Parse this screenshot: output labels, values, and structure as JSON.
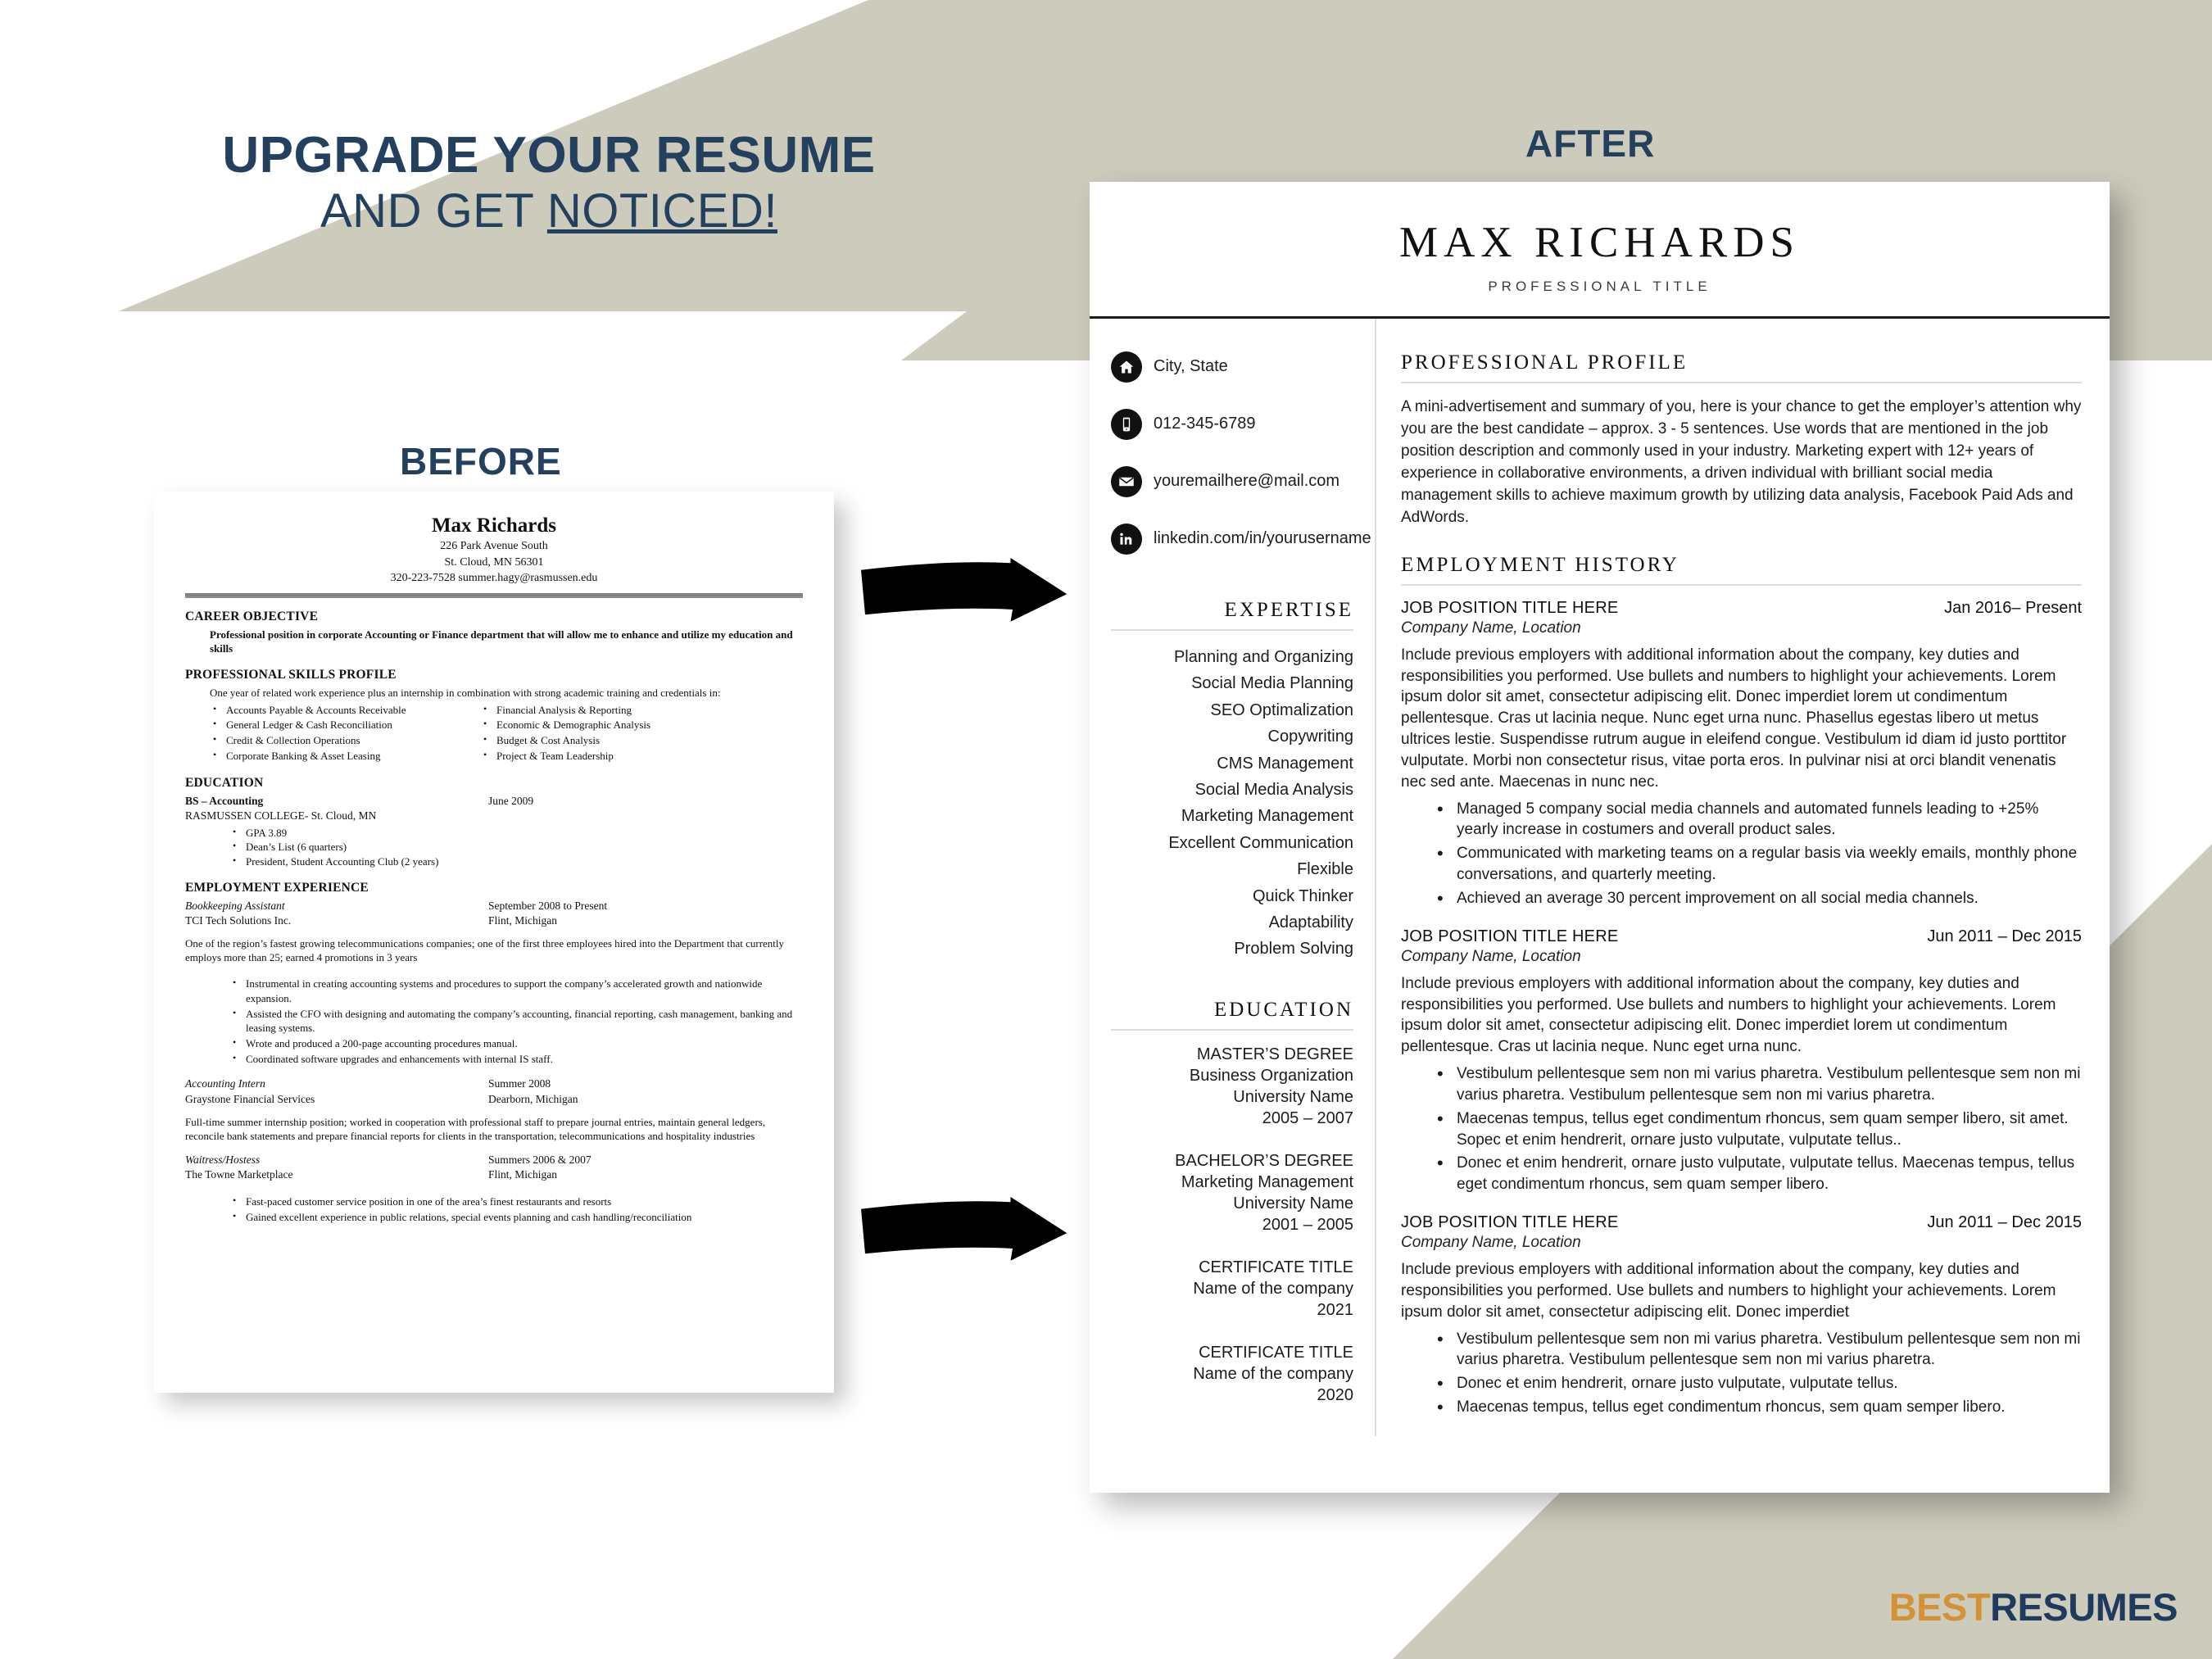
{
  "promo": {
    "headline_line1": "UPGRADE YOUR RESUME",
    "headline_line2_prefix": "AND GET ",
    "headline_line2_underlined": "NOTICED!",
    "label_before": "BEFORE",
    "label_after": "AFTER",
    "arrow_top_name": "arrow-before-to-after-top",
    "arrow_bottom_name": "arrow-before-to-after-bottom"
  },
  "brand": {
    "logo_part1": "BEST",
    "logo_part2": "RESUMES",
    "color_gold": "#d29235",
    "color_navy": "#1f3a5c",
    "color_beige": "#cdcbbc"
  },
  "before_resume": {
    "name": "Max Richards",
    "address_line1": "226 Park Avenue South",
    "address_line2": "St. Cloud, MN 56301",
    "address_line3": "320-223-7528 summer.hagy@rasmussen.edu",
    "sections": {
      "career_objective": {
        "heading": "CAREER OBJECTIVE",
        "text": "Professional position in corporate Accounting or Finance department that will allow me to enhance and utilize my education and skills"
      },
      "skills_profile": {
        "heading": "PROFESSIONAL SKILLS PROFILE",
        "intro": "One year of related work experience plus an internship in combination with strong academic training and credentials in:",
        "column_left": [
          "Accounts Payable & Accounts Receivable",
          "General Ledger & Cash Reconciliation",
          "Credit & Collection Operations",
          "Corporate Banking & Asset Leasing"
        ],
        "column_right": [
          "Financial Analysis & Reporting",
          "Economic & Demographic Analysis",
          "Budget & Cost Analysis",
          "Project & Team Leadership"
        ]
      },
      "education": {
        "heading": "EDUCATION",
        "degree": "BS – Accounting",
        "date": "June 2009",
        "school": "RASMUSSEN COLLEGE- St. Cloud, MN",
        "bullets": [
          "GPA  3.89",
          "Dean’s List (6 quarters)",
          "President, Student Accounting Club (2 years)"
        ]
      },
      "employment": {
        "heading": "EMPLOYMENT EXPERIENCE",
        "jobs": [
          {
            "title": "Bookkeeping Assistant",
            "date": "September 2008 to Present",
            "company": "TCI Tech Solutions Inc.",
            "location": "Flint, Michigan",
            "summary": "One of the region’s fastest growing telecommunications companies; one of the first three employees hired into the Department that currently employs more than 25; earned 4 promotions in 3 years",
            "bullets": [
              "Instrumental in creating accounting systems and procedures to support the company’s accelerated growth and nationwide expansion.",
              "Assisted the CFO with designing and automating the company’s accounting, financial reporting, cash management, banking and leasing systems.",
              "Wrote and produced a 200-page accounting procedures manual.",
              "Coordinated software upgrades and enhancements with internal IS staff."
            ]
          },
          {
            "title": "Accounting Intern",
            "date": "Summer 2008",
            "company": "Graystone Financial Services",
            "location": "Dearborn, Michigan",
            "summary": "Full-time summer internship position; worked in cooperation with professional staff to prepare journal entries, maintain general ledgers, reconcile bank statements and prepare financial reports for clients in the transportation, telecommunications and hospitality industries",
            "bullets": []
          },
          {
            "title": "Waitress/Hostess",
            "date": "Summers 2006 & 2007",
            "company": "The Towne Marketplace",
            "location": "Flint, Michigan",
            "summary": "",
            "bullets": [
              "Fast-paced customer service position in one of the area’s finest restaurants and resorts",
              "Gained excellent experience in public relations, special events planning and cash handling/reconciliation"
            ]
          }
        ]
      }
    }
  },
  "after_resume": {
    "name": "MAX RICHARDS",
    "title": "PROFESSIONAL TITLE",
    "contacts": [
      {
        "icon": "home-icon",
        "text": "City, State"
      },
      {
        "icon": "mobile-phone-icon",
        "text": "012-345-6789"
      },
      {
        "icon": "envelope-icon",
        "text": "youremailhere@mail.com"
      },
      {
        "icon": "linkedin-icon",
        "text": "linkedin.com/in/yourusername"
      }
    ],
    "expertise": {
      "heading": "EXPERTISE",
      "items": [
        "Planning and Organizing",
        "Social Media Planning",
        "SEO Optimalization",
        "Copywriting",
        "CMS Management",
        "Social Media Analysis",
        "Marketing Management",
        "Excellent Communication",
        "Flexible",
        "Quick Thinker",
        "Adaptability",
        "Problem Solving"
      ]
    },
    "education": {
      "heading": "EDUCATION",
      "entries": [
        {
          "degree": "MASTER’S DEGREE",
          "field": "Business Organization",
          "school": "University Name",
          "years": "2005 – 2007"
        },
        {
          "degree": "BACHELOR’S DEGREE",
          "field": "Marketing Management",
          "school": "University Name",
          "years": "2001 – 2005"
        },
        {
          "degree": "CERTIFICATE TITLE",
          "field": "Name of the company",
          "school": "2021",
          "years": ""
        },
        {
          "degree": "CERTIFICATE TITLE",
          "field": "Name of the company",
          "school": "2020",
          "years": ""
        }
      ]
    },
    "profile": {
      "heading": "PROFESSIONAL PROFILE",
      "text": "A mini-advertisement and summary of you, here is your chance to get the employer’s attention why you are the best candidate – approx. 3 - 5 sentences. Use words that are mentioned in the job position description and commonly used in your industry. Marketing expert with 12+ years of experience in collaborative environments, a driven individual with brilliant social media management skills to achieve maximum growth by utilizing data analysis, Facebook Paid Ads and AdWords."
    },
    "employment": {
      "heading": "EMPLOYMENT HISTORY",
      "jobs": [
        {
          "title": "JOB POSITION TITLE HERE",
          "date": "Jan 2016– Present",
          "company": "Company Name, Location",
          "description": "Include previous employers with additional information about the company, key duties and responsibilities you performed. Use bullets and numbers to highlight your achievements. Lorem ipsum dolor sit amet, consectetur adipiscing elit. Donec imperdiet lorem ut condimentum pellentesque. Cras ut lacinia neque. Nunc eget urna nunc. Phasellus egestas libero ut metus ultrices lestie. Suspendisse rutrum augue in eleifend congue. Vestibulum id diam id justo porttitor vulputate. Morbi non consectetur risus, vitae porta eros. In pulvinar nisi at orci blandit venenatis nec sed ante. Maecenas in nunc nec.",
          "bullets": [
            "Managed 5 company social media channels and automated funnels leading to +25% yearly increase in costumers and overall product sales.",
            "Communicated with marketing teams on a regular basis via weekly emails, monthly phone conversations, and quarterly meeting.",
            "Achieved an average 30 percent improvement on all social media channels."
          ]
        },
        {
          "title": "JOB POSITION TITLE HERE",
          "date": "Jun 2011 – Dec 2015",
          "company": "Company Name, Location",
          "description": "Include previous employers with additional information about the company, key duties and responsibilities you performed. Use bullets and numbers to highlight your achievements. Lorem ipsum dolor sit amet, consectetur adipiscing elit. Donec imperdiet lorem ut condimentum pellentesque. Cras ut lacinia neque. Nunc eget urna nunc.",
          "bullets": [
            "Vestibulum pellentesque sem non mi varius pharetra. Vestibulum pellentesque sem non mi varius pharetra. Vestibulum pellentesque sem non mi varius pharetra.",
            "Maecenas tempus, tellus eget condimentum rhoncus, sem quam semper libero, sit amet. Sopec et enim hendrerit, ornare justo vulputate, vulputate tellus..",
            "Donec et enim hendrerit, ornare justo vulputate, vulputate tellus. Maecenas tempus, tellus eget condimentum rhoncus, sem quam semper libero."
          ]
        },
        {
          "title": "JOB POSITION TITLE HERE",
          "date": "Jun 2011 – Dec 2015",
          "company": "Company Name, Location",
          "description": "Include previous employers with additional information about the company, key duties and responsibilities you performed. Use bullets and numbers to highlight your achievements. Lorem ipsum dolor sit amet, consectetur adipiscing elit. Donec imperdiet",
          "bullets": [
            "Vestibulum pellentesque sem non mi varius pharetra. Vestibulum pellentesque sem non mi varius pharetra. Vestibulum pellentesque sem non mi varius pharetra.",
            "Donec et enim hendrerit, ornare justo vulputate, vulputate tellus.",
            "Maecenas tempus, tellus eget condimentum rhoncus, sem quam semper libero."
          ]
        }
      ]
    }
  }
}
